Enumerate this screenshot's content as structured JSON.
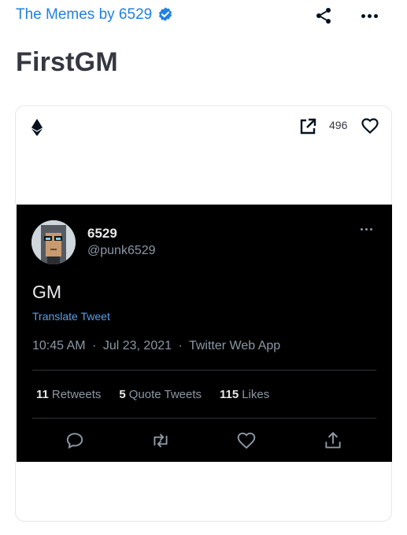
{
  "header": {
    "collection_name": "The Memes by 6529",
    "verified_icon": "verified-badge-icon",
    "share_icon": "share-icon",
    "more_icon": "more-options-icon"
  },
  "item": {
    "title": "FirstGM"
  },
  "card": {
    "chain_icon": "ethereum-icon",
    "open_icon": "open-external-icon",
    "favorites_count": "496",
    "favorite_icon": "heart-icon"
  },
  "tweet": {
    "author_name": "6529",
    "author_handle": "@punk6529",
    "text": "GM",
    "translate_label": "Translate Tweet",
    "time": "10:45 AM",
    "date": "Jul 23, 2021",
    "source": "Twitter Web App",
    "separator": "·",
    "stats": [
      {
        "count": "11",
        "label": "Retweets"
      },
      {
        "count": "5",
        "label": "Quote Tweets"
      },
      {
        "count": "115",
        "label": "Likes"
      }
    ],
    "actions": [
      "reply-icon",
      "retweet-icon",
      "like-icon",
      "share-icon"
    ]
  },
  "colors": {
    "accent": "#2081e2",
    "title": "#353840",
    "tweet_bg": "#000000",
    "tweet_link": "#5b9fe9",
    "tweet_muted": "#8b98a5"
  }
}
